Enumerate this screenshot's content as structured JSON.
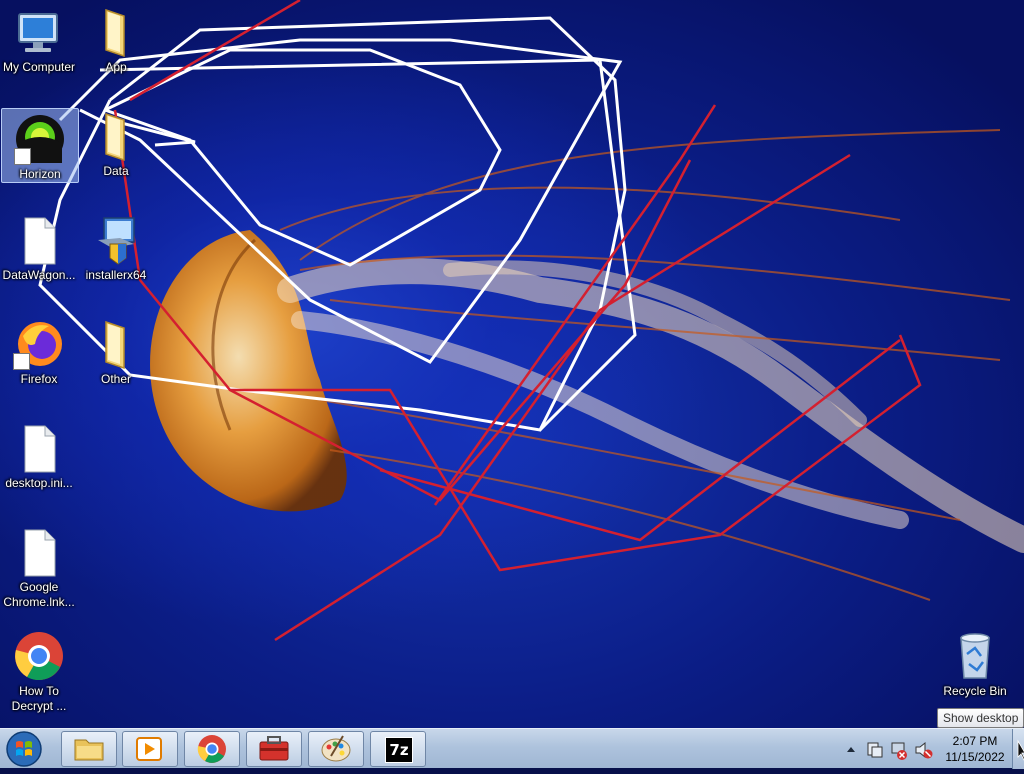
{
  "desktop_icons": [
    {
      "label": "My Computer",
      "icon": "computer-icon"
    },
    {
      "label": "App",
      "icon": "folder-icon"
    },
    {
      "label": "Horizon",
      "icon": "horizon-app-icon",
      "selected": true
    },
    {
      "label": "Data",
      "icon": "folder-icon"
    },
    {
      "label": "DataWagon...",
      "icon": "file-icon"
    },
    {
      "label": "installerx64",
      "icon": "installer-icon"
    },
    {
      "label": "Firefox",
      "icon": "firefox-icon"
    },
    {
      "label": "Other",
      "icon": "folder-icon"
    },
    {
      "label": "desktop.ini...",
      "icon": "file-icon"
    },
    {
      "label": "Google Chrome.lnk...",
      "icon": "file-icon"
    },
    {
      "label": "How To Decrypt ...",
      "icon": "chrome-icon"
    },
    {
      "label": "Recycle Bin",
      "icon": "recycle-bin-icon"
    }
  ],
  "taskbar": {
    "pinned": [
      {
        "name": "file-explorer",
        "icon": "folder-icon"
      },
      {
        "name": "media-player",
        "icon": "media-player-icon"
      },
      {
        "name": "chrome",
        "icon": "chrome-icon"
      },
      {
        "name": "toolbox",
        "icon": "toolbox-icon"
      },
      {
        "name": "paint",
        "icon": "paint-palette-icon"
      },
      {
        "name": "7zip",
        "icon": "7zip-icon",
        "text": "7z"
      }
    ],
    "clock_time": "2:07 PM",
    "clock_date": "11/15/2022",
    "tooltip": "Show desktop"
  },
  "colors": {
    "accent": "#1b3fc0",
    "jellyfish": "#e88a1a",
    "red_lines": "#d42030"
  }
}
